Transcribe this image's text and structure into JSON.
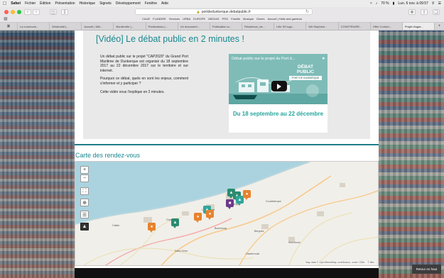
{
  "menubar": {
    "app": "Safari",
    "items": [
      "Fichier",
      "Édition",
      "Présentation",
      "Historique",
      "Signets",
      "Développement",
      "Fenêtre",
      "Aide"
    ],
    "battery": "70 %",
    "clock": "Lun. 6 nov. à 09:57"
  },
  "toolbar": {
    "url": "portdedunkerque.debatpublic.fr"
  },
  "favorites": [
    "CAUE",
    "FLANDRE",
    "Services",
    "URBA",
    "EUROPE",
    "MEDIAS",
    "PRO",
    "Famille",
    "Musique",
    "Divers",
    "Accueil | Halls and gardens"
  ],
  "tabs": [
    "La commune...",
    "Wimbolatt (...",
    "Accueil | Wik...",
    "Borderville (...",
    "Publications (...",
    "Un document...",
    "Publication w...",
    "Résidence_de...",
    "Lille S3 logo...",
    "Wit Stepheni...",
    "CONSTRUIRE...",
    "Offre Confort...",
    "Projet d'agre..."
  ],
  "video_section": {
    "title": "[Vidéo] Le débat public en 2 minutes !",
    "paragraphs": [
      "Un débat public sur le projet \"CAP2020\" du Grand Port Maritime de Dunkerque est organisé du 18 septembre 2017 au 22 décembre 2017 sur le territoire et sur internet.",
      "Pourquoi ce débat, quels en sont les enjeux, comment s'informer et y participer ?",
      "Cette vidéo vous l'explique en 2 minutes."
    ],
    "player": {
      "caption": "Débat public sur le projet du Port d...",
      "brand_line1": "DÉBAT PUBLIC",
      "brand_line2": "PORT DE DUNKERQUE",
      "date_banner": "Du 18 septembre au 22 décembre"
    }
  },
  "map_section": {
    "title": "Carte des rendez-vous",
    "controls": [
      "+",
      "−"
    ],
    "attribution": "Map data © OpenStreetMap contributors, under ODbL · © tiles",
    "places": [
      "Dunkerque",
      "Gravelines",
      "Loon-Plage",
      "Bourbourg",
      "Bergues",
      "Coudekerque",
      "Saint-Omer",
      "Hazebrouck",
      "Wormhout",
      "Calais"
    ]
  },
  "back_to_top": "Retour en haut",
  "colors": {
    "accent": "#19878f",
    "marker_orange": "#e7832d",
    "marker_green": "#2b8b6f",
    "marker_purple": "#6d3a8a"
  }
}
